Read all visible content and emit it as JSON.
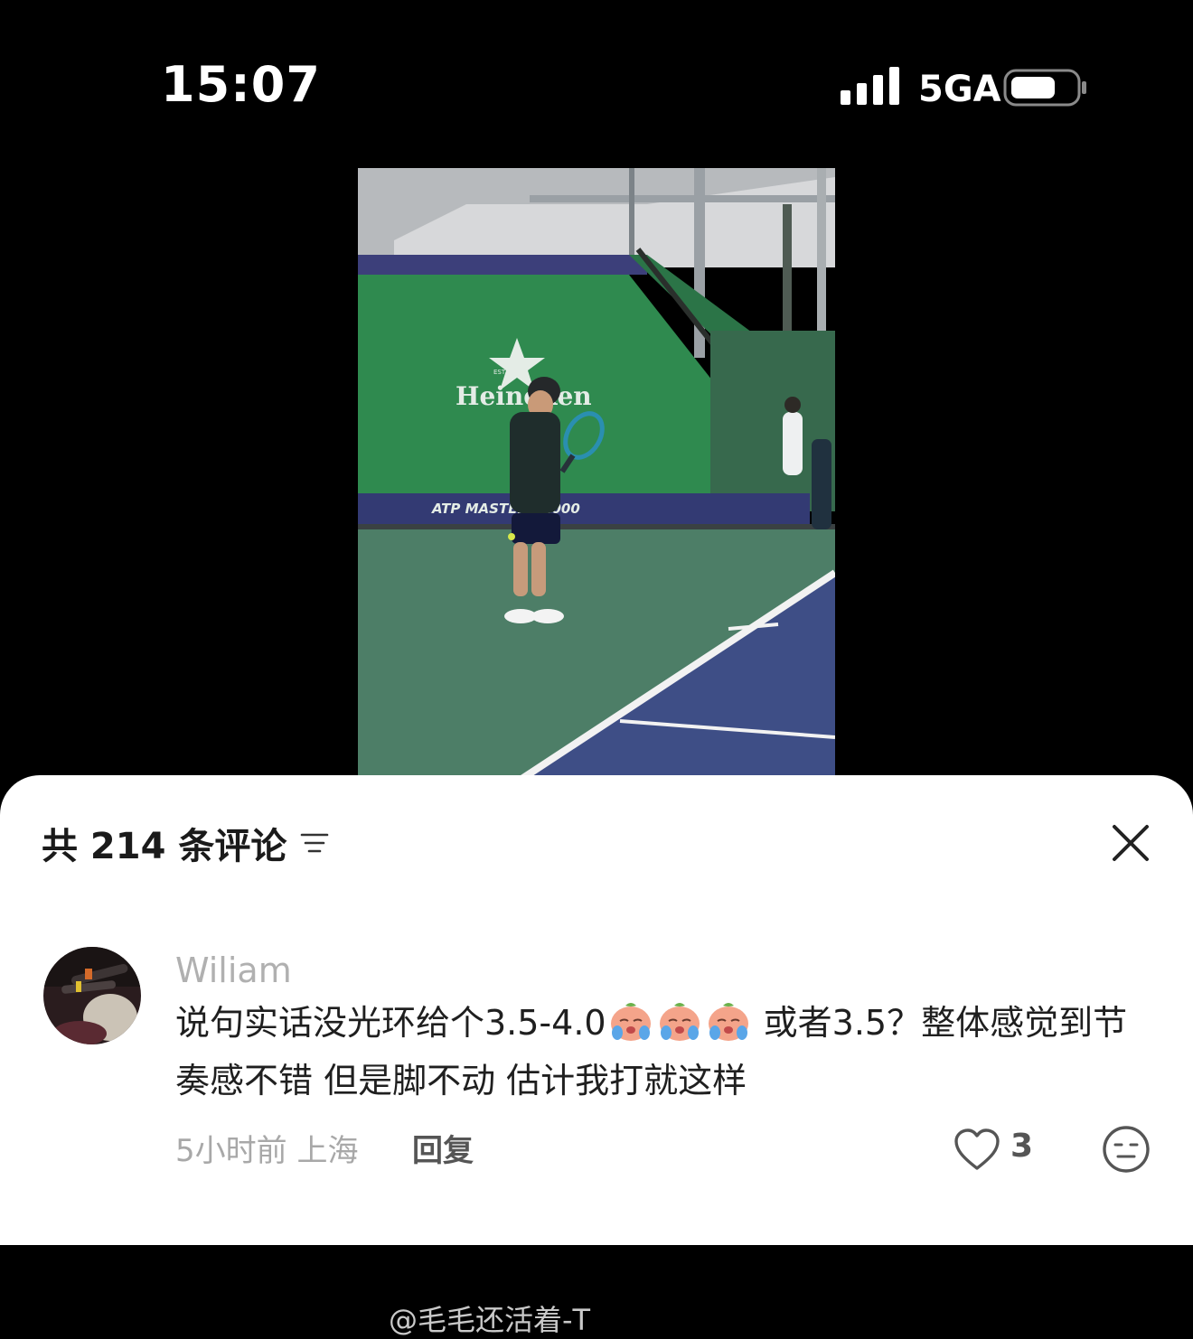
{
  "status": {
    "time": "15:07",
    "network": "5GA"
  },
  "comments_panel": {
    "count_title": "共 214 条评论",
    "comment": {
      "username": "Wiliam",
      "text_part1": "说句实话没光环给个3.5-4.0",
      "text_part2": " 或者3.5？整体感觉到节奏感不错 但是脚不动 估计我打就这样",
      "meta": "5小时前 上海",
      "reply_label": "回复",
      "like_count": "3"
    },
    "watermark": "@毛毛还活着-T"
  },
  "video": {
    "banner_brand": "Heineken",
    "banner_est": "EST. 1873",
    "banner_footer": "ATP MASTERS 1000"
  },
  "colors": {
    "accent": "#ffffff",
    "banner_green": "#2f8a4f",
    "court_blue": "#3e4e86",
    "court_green": "#4d7e67"
  }
}
